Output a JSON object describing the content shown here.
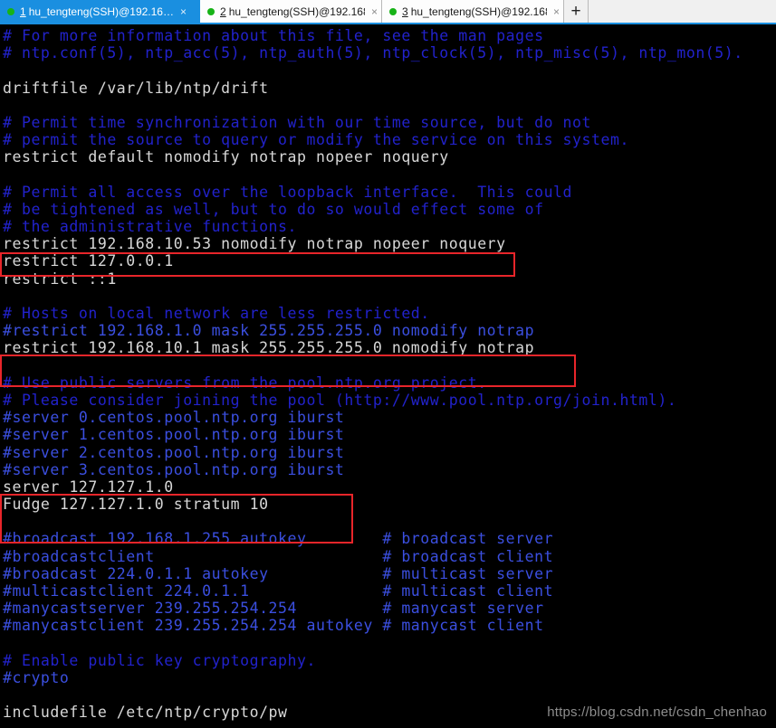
{
  "tabbar": {
    "tabs": [
      {
        "num": "1",
        "title": "hu_tengteng(SSH)@192.16…",
        "status_icon": "green-dot-icon",
        "close_icon": "×",
        "active": true
      },
      {
        "num": "2",
        "title": "hu_tengteng(SSH)@192.168….",
        "status_icon": "green-dot-icon",
        "close_icon": "×",
        "active": false
      },
      {
        "num": "3",
        "title": "hu_tengteng(SSH)@192.168….",
        "status_icon": "green-dot-icon",
        "close_icon": "×",
        "active": false
      }
    ],
    "new_tab_label": "+",
    "active_tab_color": "#1a8fe0",
    "status_dot_color": "#17b317"
  },
  "terminal": {
    "background_color": "#000000",
    "command_color": "#d8d8d8",
    "comment_color": "#2222cc",
    "lines": [
      {
        "text": "# For more information about this file, see the man pages",
        "kind": "comment"
      },
      {
        "text": "# ntp.conf(5), ntp_acc(5), ntp_auth(5), ntp_clock(5), ntp_misc(5), ntp_mon(5).",
        "kind": "comment"
      },
      {
        "text": "",
        "kind": "blank"
      },
      {
        "text": "driftfile /var/lib/ntp/drift",
        "kind": "command"
      },
      {
        "text": "",
        "kind": "blank"
      },
      {
        "text": "# Permit time synchronization with our time source, but do not",
        "kind": "comment"
      },
      {
        "text": "# permit the source to query or modify the service on this system.",
        "kind": "comment"
      },
      {
        "text": "restrict default nomodify notrap nopeer noquery",
        "kind": "command"
      },
      {
        "text": "",
        "kind": "blank"
      },
      {
        "text": "# Permit all access over the loopback interface.  This could",
        "kind": "comment"
      },
      {
        "text": "# be tightened as well, but to do so would effect some of",
        "kind": "comment"
      },
      {
        "text": "# the administrative functions.",
        "kind": "comment"
      },
      {
        "text": "restrict 192.168.10.53 nomodify notrap nopeer noquery",
        "kind": "command"
      },
      {
        "text": "restrict 127.0.0.1",
        "kind": "command"
      },
      {
        "text": "restrict ::1",
        "kind": "command"
      },
      {
        "text": "",
        "kind": "blank"
      },
      {
        "text": "# Hosts on local network are less restricted.",
        "kind": "comment"
      },
      {
        "text": "#restrict 192.168.1.0 mask 255.255.255.0 nomodify notrap",
        "kind": "comment2"
      },
      {
        "text": "restrict 192.168.10.1 mask 255.255.255.0 nomodify notrap",
        "kind": "command"
      },
      {
        "text": "",
        "kind": "blank"
      },
      {
        "text": "# Use public servers from the pool.ntp.org project.",
        "kind": "comment"
      },
      {
        "text": "# Please consider joining the pool (http://www.pool.ntp.org/join.html).",
        "kind": "comment"
      },
      {
        "text": "#server 0.centos.pool.ntp.org iburst",
        "kind": "comment2"
      },
      {
        "text": "#server 1.centos.pool.ntp.org iburst",
        "kind": "comment2"
      },
      {
        "text": "#server 2.centos.pool.ntp.org iburst",
        "kind": "comment2"
      },
      {
        "text": "#server 3.centos.pool.ntp.org iburst",
        "kind": "comment2"
      },
      {
        "text": "server 127.127.1.0",
        "kind": "command"
      },
      {
        "text": "Fudge 127.127.1.0 stratum 10",
        "kind": "command"
      },
      {
        "text": "",
        "kind": "blank"
      },
      {
        "text": "#broadcast 192.168.1.255 autokey        # broadcast server",
        "kind": "comment2"
      },
      {
        "text": "#broadcastclient                        # broadcast client",
        "kind": "comment2"
      },
      {
        "text": "#broadcast 224.0.1.1 autokey            # multicast server",
        "kind": "comment2"
      },
      {
        "text": "#multicastclient 224.0.1.1              # multicast client",
        "kind": "comment2"
      },
      {
        "text": "#manycastserver 239.255.254.254         # manycast server",
        "kind": "comment2"
      },
      {
        "text": "#manycastclient 239.255.254.254 autokey # manycast client",
        "kind": "comment2"
      },
      {
        "text": "",
        "kind": "blank"
      },
      {
        "text": "# Enable public key cryptography.",
        "kind": "comment"
      },
      {
        "text": "#crypto",
        "kind": "comment2"
      },
      {
        "text": "",
        "kind": "blank"
      },
      {
        "text": "includefile /etc/ntp/crypto/pw",
        "kind": "command"
      }
    ],
    "highlights": [
      {
        "label": "restrict-client-line",
        "color": "#e8252a"
      },
      {
        "label": "restrict-local-network-line",
        "color": "#e8252a"
      },
      {
        "label": "local-clock-server-block",
        "color": "#e8252a"
      }
    ]
  },
  "watermark": {
    "text": "https://blog.csdn.net/csdn_chenhao"
  }
}
